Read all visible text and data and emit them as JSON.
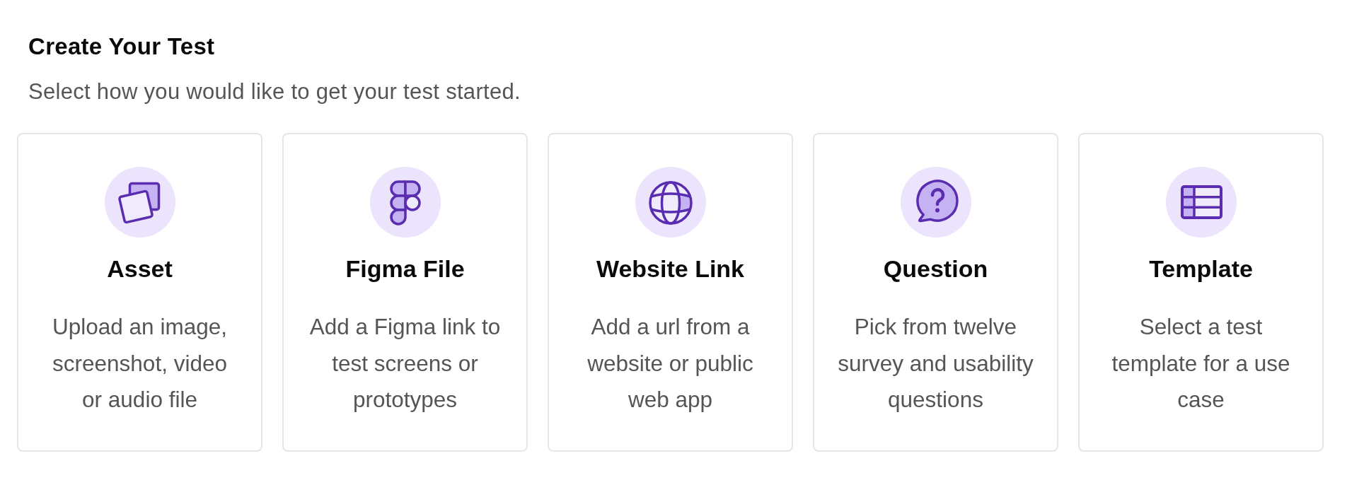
{
  "header": {
    "title": "Create Your Test",
    "subtitle": "Select how you would like to get your test started."
  },
  "options": [
    {
      "kind": "asset",
      "title": "Asset",
      "description": "Upload an image, screenshot, video or audio file"
    },
    {
      "kind": "figma",
      "title": "Figma File",
      "description": "Add a Figma link to test screens or prototypes"
    },
    {
      "kind": "website",
      "title": "Website Link",
      "description": "Add a url from a website or public web app"
    },
    {
      "kind": "question",
      "title": "Question",
      "description": "Pick from twelve survey and usability questions"
    },
    {
      "kind": "template",
      "title": "Template",
      "description": "Select a test template for a use case"
    }
  ]
}
